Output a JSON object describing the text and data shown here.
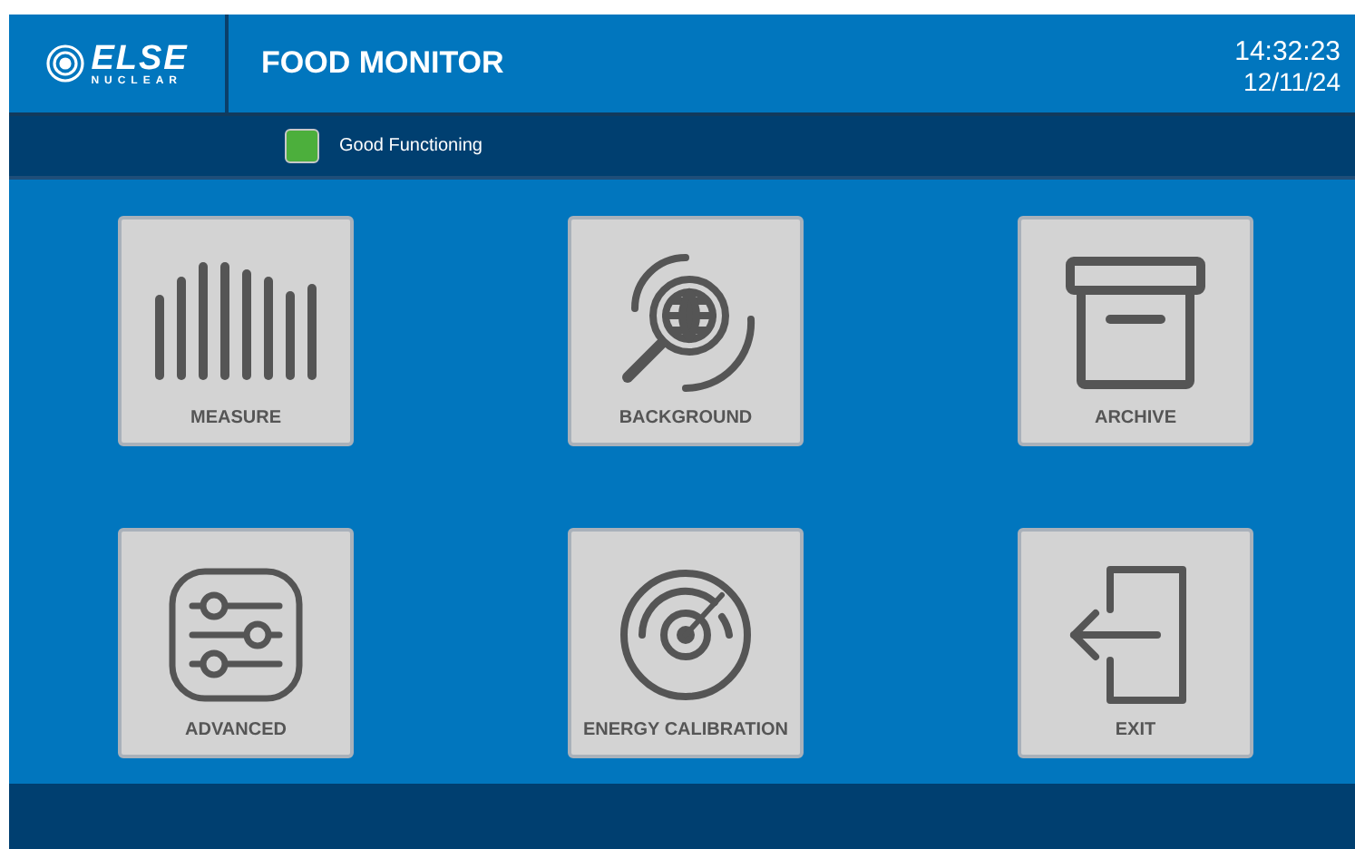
{
  "header": {
    "logo": {
      "word": "ELSE",
      "subword": "NUCLEAR"
    },
    "title": "FOOD MONITOR",
    "time": "14:32:23",
    "date": "12/11/24"
  },
  "status": {
    "kind": "ok",
    "label": "Good Functioning"
  },
  "tiles": [
    {
      "kind": "measure",
      "label": "MEASURE"
    },
    {
      "kind": "background",
      "label": "BACKGROUND"
    },
    {
      "kind": "archive",
      "label": "ARCHIVE"
    },
    {
      "kind": "advanced",
      "label": "ADVANCED"
    },
    {
      "kind": "calibration",
      "label": "ENERGY CALIBRATION"
    },
    {
      "kind": "exit",
      "label": "EXIT"
    }
  ]
}
